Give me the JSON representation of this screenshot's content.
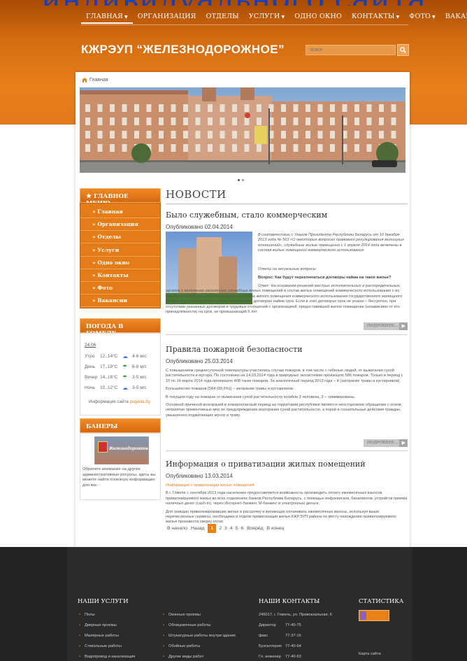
{
  "top_watermark": "индивидуального сайта",
  "nav": {
    "items": [
      {
        "label": "ГЛАВНАЯ",
        "caret": true
      },
      {
        "label": "ОРГАНИЗАЦИЯ",
        "caret": false
      },
      {
        "label": "ОТДЕЛЫ",
        "caret": false
      },
      {
        "label": "УСЛУГИ",
        "caret": true
      },
      {
        "label": "ОДНО ОКНО",
        "caret": false
      },
      {
        "label": "КОНТАКТЫ",
        "caret": true
      },
      {
        "label": "ФОТО",
        "caret": true
      },
      {
        "label": "ВАКАНСИИ",
        "caret": false
      }
    ]
  },
  "site_title": "КЖРЭУП “ЖЕЛЕЗНОДОРОЖНОЕ”",
  "search": {
    "placeholder": "поиск"
  },
  "breadcrumb": {
    "home": "Главная"
  },
  "sidebar": {
    "menu_title": "ГЛАВНОЕ МЕНЮ",
    "menu_items": [
      "Главная",
      "Организация",
      "Отделы",
      "Услуги",
      "Одно окно",
      "Контакты",
      "Фото",
      "Вакансии"
    ],
    "weather_title": "ПОГОДА В ГОМЕЛЕ",
    "weather_date": "24.06",
    "weather_rows": [
      {
        "part": "Утро",
        "temp": "12..14°C",
        "wind": "4-6 м/с"
      },
      {
        "part": "День",
        "temp": "17..19°C",
        "wind": "6-8 м/с"
      },
      {
        "part": "Вечер",
        "temp": "14..16°C",
        "wind": "3-5 м/с"
      },
      {
        "part": "Ночь",
        "temp": "10..12°C",
        "wind": "3-5 м/с"
      }
    ],
    "weather_source": "Информация сайта",
    "weather_source_link": "pogoda.by",
    "banners_title": "БАНЕРЫ",
    "banner_caption": "Железнодорожное",
    "banner_text": "Обратите внимание на другие административные ресурсы, здесь вы можете найти полезную информацию для вас"
  },
  "news": {
    "heading": "НОВОСТИ",
    "more_label": "ПОДРОБНЕЕ...",
    "articles": [
      {
        "title": "Было служебным, стало коммерческим",
        "published": "Опубликовано 02.04.2014",
        "intro": "В соответствии с Указом Президента Республики Беларусь от 16 декабря 2013 года № 563 «О некоторых вопросах правового регулирования жилищных отношений», служебные жилые помещения с 1 апреля 2014 года включены в состав жилых помещений коммерческого использования",
        "p1": "Ответы на актуальные вопросы",
        "q1": "Вопрос: Как будут переключаться договоры найма на такое жилье?",
        "p2": "Ответ: На основании решений местных исполнительных и распорядительных органов о включении заселенных служебных жилых помещений в состав жилых помещений коммерческого использования с их нанимателями будут заключены договоры найма жилого помещения коммерческого использования государственного жилищного фонда на установленный в ранее заключенных договорах найма срок. Если в этих договорах срок не указан – бессрочно, при отсутствии указанных договоров и трудовых отношений с организацией, предоставившей жилое помещение (независимо от его принадлежности) на срок, не превышающий 5 лет."
      },
      {
        "title": "Правила пожарной безопасности",
        "published": "Опубликовано 25.03.2014",
        "p1": "С повышением среднесуточной температуры участились случаи пожаров, в том числе с гибелью людей, от выжигания сухой растительности и мусора. По состоянию на 14.03.2014 года в природных экосистемах произошло 586 пожаров. Только в период с 10 по 14 марта 2014 года произошло 408 таких пожаров. За аналогичный период 2013 года – 4 (загорание травы и кустарников).",
        "p2": "Большинство пожаров (584 (99,6%)) – загорание травы и кустарников.",
        "p3": "В текущем году на пожарах от выжигания сухой растительности погибли 3 человека, 3 – травмированы.",
        "p4": "Основной причиной возгораний в пожароопасный период на территории республики является неосторожное обращение с огнем, неприятие превентивных мер по предупреждению возгорания сухой растительности, а порой и сознательные действия граждан, умышленно поджигающих мусор и траву."
      },
      {
        "title": "Информация о приватизации жилых помещений",
        "published": "Опубликовано 13.03.2014",
        "link": "Информация о приватизации жилых помещений",
        "p1": "В г. Гомеле с сентября 2013 года населению предоставляется возможность производить оплату ежемесячных взносов приватизируемого жилья во всех отделениях банков Республики Беларусь, с помощью инфокиосков, банкоматов, устройств приема наличных денег (cash-in), через Интернет-банкинг, М-банкинг и электронные деньги.",
        "p2": "Для граждан приватизировавших жилье в рассрочку и желающих оплачивать ежемесячные взносы, используя выше перечисленные сервисы, необходимо в отделе приватизации жилья КЖРЭУП района по месту нахождения приватизируемого жилья произвести сверку оплат."
      }
    ],
    "pagination": {
      "start": "В начало",
      "prev": "Назад",
      "pages": [
        "1",
        "2",
        "3",
        "4",
        "5",
        "6"
      ],
      "current": "1",
      "next": "Вперёд",
      "end": "В конец"
    }
  },
  "footer": {
    "services_title": "НАШИ УСЛУГИ",
    "services_col1": [
      "Полы",
      "Дверные проемы",
      "Малярные работы",
      "Стекольные работы",
      "Водопровод и канализация"
    ],
    "services_col2": [
      "Оконные проемы",
      "Облицовочные работы",
      "Штукатурные работы внутри здания",
      "Обойные работы",
      "Другие виды работ"
    ],
    "contacts_title": "НАШИ КОНТАКТЫ",
    "contacts": [
      {
        "label": "246017, г. Гомель, ул. Привокзальная, 6",
        "value": ""
      },
      {
        "label": "Директор",
        "value": "77-40-75"
      },
      {
        "label": "факс",
        "value": "77-37-16"
      },
      {
        "label": "Бухгалтерия",
        "value": "77-40-64"
      },
      {
        "label": "Гл. инженер",
        "value": "77-40-63"
      }
    ],
    "stats_title": "СТАТИСТИКА",
    "sitemap": "Карта сайта"
  },
  "colors": {
    "brand_orange": "#e8801a",
    "footer_bg": "#2b2b2b"
  }
}
